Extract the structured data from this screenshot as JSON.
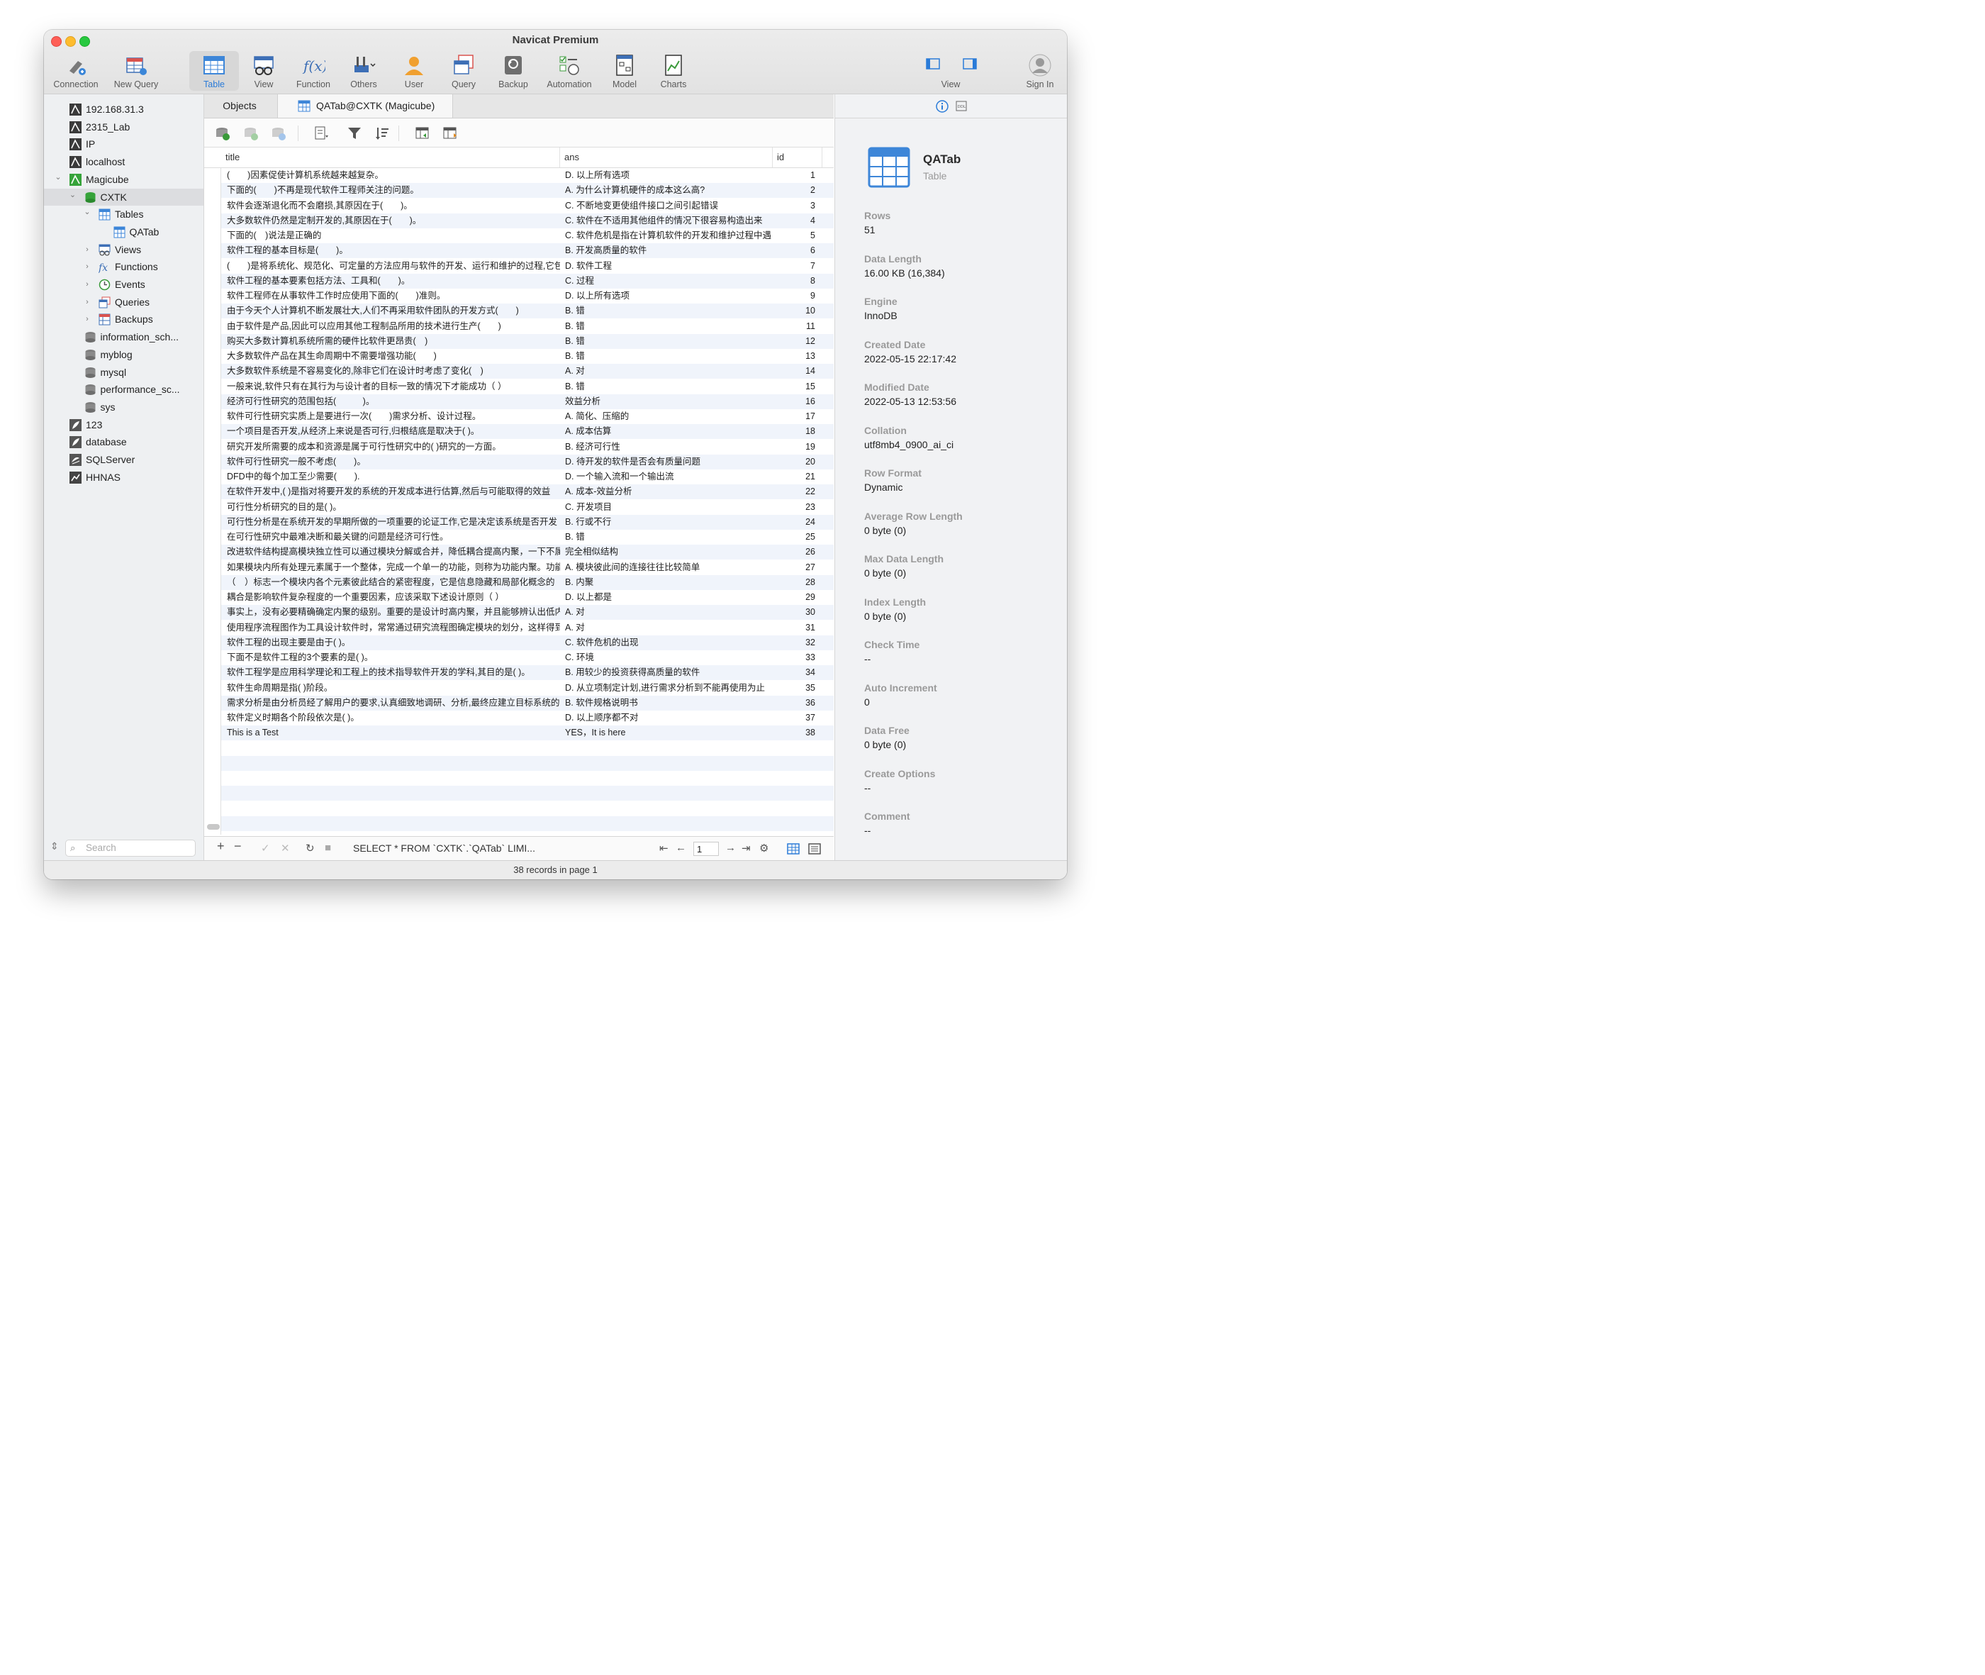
{
  "window": {
    "title": "Navicat Premium",
    "status": "38 records in page 1"
  },
  "toolbar": {
    "items": [
      {
        "label": "Connection",
        "icon": "connection-icon"
      },
      {
        "label": "New Query",
        "icon": "new-query-icon"
      },
      {
        "label": "Table",
        "icon": "table-icon",
        "active": true
      },
      {
        "label": "View",
        "icon": "view-icon"
      },
      {
        "label": "Function",
        "icon": "function-icon"
      },
      {
        "label": "Others",
        "icon": "others-icon"
      },
      {
        "label": "User",
        "icon": "user-icon"
      },
      {
        "label": "Query",
        "icon": "query-icon"
      },
      {
        "label": "Backup",
        "icon": "backup-icon"
      },
      {
        "label": "Automation",
        "icon": "automation-icon"
      },
      {
        "label": "Model",
        "icon": "model-icon"
      },
      {
        "label": "Charts",
        "icon": "charts-icon"
      }
    ],
    "view_label": "View",
    "signin_label": "Sign In"
  },
  "sidebar": {
    "items": [
      {
        "label": "192.168.31.3"
      },
      {
        "label": "2315_Lab"
      },
      {
        "label": "IP"
      },
      {
        "label": "localhost"
      },
      {
        "label": "Magicube"
      },
      {
        "label": "CXTK"
      },
      {
        "label": "Tables"
      },
      {
        "label": "QATab"
      },
      {
        "label": "Views"
      },
      {
        "label": "Functions"
      },
      {
        "label": "Events"
      },
      {
        "label": "Queries"
      },
      {
        "label": "Backups"
      },
      {
        "label": "information_sch..."
      },
      {
        "label": "myblog"
      },
      {
        "label": "mysql"
      },
      {
        "label": "performance_sc..."
      },
      {
        "label": "sys"
      },
      {
        "label": "123"
      },
      {
        "label": "database"
      },
      {
        "label": "SQLServer"
      },
      {
        "label": "HHNAS"
      }
    ],
    "search_placeholder": "Search"
  },
  "tabs": {
    "objects": "Objects",
    "active": "QATab@CXTK (Magicube)"
  },
  "grid": {
    "columns": [
      "title",
      "ans",
      "id"
    ],
    "rows": [
      [
        "(　　)因素促使计算机系统越来越复杂。",
        "D. 以上所有选项",
        "1"
      ],
      [
        "下面的(　　)不再是现代软件工程师关注的问题。",
        "A. 为什么计算机硬件的成本这么高?",
        "2"
      ],
      [
        "软件会逐渐退化而不会磨损,其原因在于(　　)。",
        "C. 不断地变更使组件接口之间引起错误",
        "3"
      ],
      [
        "大多数软件仍然是定制开发的,其原因在于(　　)。",
        "C. 软件在不适用其他组件的情况下很容易构造出来",
        "4"
      ],
      [
        "下面的(　)说法是正确的",
        "C. 软件危机是指在计算机软件的开发和维护过程中遇",
        "5"
      ],
      [
        "软件工程的基本目标是(　　)。",
        "B. 开发高质量的软件",
        "6"
      ],
      [
        "(　　)是将系统化、规范化、可定量的方法应用与软件的开发、运行和维护的过程,它包",
        "D. 软件工程",
        "7"
      ],
      [
        "软件工程的基本要素包括方法、工具和(　　)。",
        "C. 过程",
        "8"
      ],
      [
        "软件工程师在从事软件工作时应使用下面的(　　)准则。",
        "D. 以上所有选项",
        "9"
      ],
      [
        "由于今天个人计算机不断发展壮大,人们不再采用软件团队的开发方式(　　)",
        "B. 错",
        "10"
      ],
      [
        "由于软件是产品,因此可以应用其他工程制品所用的技术进行生产(　　)",
        "B. 错",
        "11"
      ],
      [
        "购买大多数计算机系统所需的硬件比软件更昂贵(　)",
        "B. 错",
        "12"
      ],
      [
        "大多数软件产品在其生命周期中不需要增强功能(　　)",
        "B. 错",
        "13"
      ],
      [
        "大多数软件系统是不容易变化的,除非它们在设计时考虑了变化(　)",
        "A. 对",
        "14"
      ],
      [
        "一般来说,软件只有在其行为与设计者的目标一致的情况下才能成功（ ）",
        "B. 错",
        "15"
      ],
      [
        "经济可行性研究的范围包括(　　　)。",
        "效益分析",
        "16"
      ],
      [
        "软件可行性研究实质上是要进行一次(　　)需求分析、设计过程。",
        "A. 简化、压缩的",
        "17"
      ],
      [
        "一个项目是否开发,从经济上来说是否可行,归根结底是取决于( )。",
        "A. 成本估算",
        "18"
      ],
      [
        "研究开发所需要的成本和资源是属于可行性研究中的( )研究的一方面。",
        "B. 经济可行性",
        "19"
      ],
      [
        "软件可行性研究一般不考虑(　　)。",
        "D. 待开发的软件是否会有质量问题",
        "20"
      ],
      [
        "DFD中的每个加工至少需要(　　).",
        "D. 一个输入流和一个输出流",
        "21"
      ],
      [
        "在软件开发中,( )是指对将要开发的系统的开发成本进行估算,然后与可能取得的效益",
        "A. 成本-效益分析",
        "22"
      ],
      [
        "可行性分析研究的目的是( )。",
        "C. 开发项目",
        "23"
      ],
      [
        "可行性分析是在系统开发的早期所做的一项重要的论证工作,它是决定该系统是否开发",
        "B. 行或不行",
        "24"
      ],
      [
        "在可行性研究中最难决断和最关键的问题是经济可行性。",
        "B. 错",
        "25"
      ],
      [
        "改进软件结构提高模块独立性可以通过模块分解或合并，降低耦合提高内聚，一下不属",
        "完全相似结构",
        "26"
      ],
      [
        "如果模块内所有处理元素属于一个整体，完成一个单一的功能，则称为功能内聚。功能",
        "A. 模块彼此间的连接往往比较简单",
        "27"
      ],
      [
        "（　）标志一个模块内各个元素彼此结合的紧密程度，它是信息隐藏和局部化概念的",
        "B. 内聚",
        "28"
      ],
      [
        "耦合是影响软件复杂程度的一个重要因素，应该采取下述设计原则（ ）",
        "D. 以上都是",
        "29"
      ],
      [
        "事实上，没有必要精确确定内聚的级别。重要的是设计时高内聚，并且能够辨认出低内",
        "A. 对",
        "30"
      ],
      [
        "使用程序流程图作为工具设计软件时，常常通过研究流程图确定模块的划分，这样得到",
        "A. 对",
        "31"
      ],
      [
        "软件工程的出现主要是由于( )。",
        "C. 软件危机的出现",
        "32"
      ],
      [
        "下面不是软件工程的3个要素的是( )。",
        "C. 环境",
        "33"
      ],
      [
        "软件工程学是应用科学理论和工程上的技术指导软件开发的学科,其目的是( )。",
        "B. 用较少的投资获得高质量的软件",
        "34"
      ],
      [
        "软件生命周期是指( )阶段。",
        "D. 从立项制定计划,进行需求分析到不能再使用为止",
        "35"
      ],
      [
        "需求分析是由分析员经了解用户的要求,认真细致地调研、分析,最终应建立目标系统的",
        "B. 软件规格说明书",
        "36"
      ],
      [
        "软件定义时期各个阶段依次是( )。",
        "D. 以上顺序都不对",
        "37"
      ],
      [
        "This is a Test",
        "YES，It is here",
        "38"
      ]
    ]
  },
  "bottombar": {
    "sql": "SELECT * FROM `CXTK`.`QATab` LIMI...",
    "page": "1"
  },
  "info": {
    "name": "QATab",
    "type": "Table",
    "props": [
      {
        "label": "Rows",
        "value": "51"
      },
      {
        "label": "Data Length",
        "value": "16.00 KB (16,384)"
      },
      {
        "label": "Engine",
        "value": "InnoDB"
      },
      {
        "label": "Created Date",
        "value": "2022-05-15 22:17:42"
      },
      {
        "label": "Modified Date",
        "value": "2022-05-13 12:53:56"
      },
      {
        "label": "Collation",
        "value": "utf8mb4_0900_ai_ci"
      },
      {
        "label": "Row Format",
        "value": "Dynamic"
      },
      {
        "label": "Average Row Length",
        "value": "0 byte (0)"
      },
      {
        "label": "Max Data Length",
        "value": "0 byte (0)"
      },
      {
        "label": "Index Length",
        "value": "0 byte (0)"
      },
      {
        "label": "Check Time",
        "value": "--"
      },
      {
        "label": "Auto Increment",
        "value": "0"
      },
      {
        "label": "Data Free",
        "value": "0 byte (0)"
      },
      {
        "label": "Create Options",
        "value": "--"
      },
      {
        "label": "Comment",
        "value": "--"
      }
    ]
  },
  "colors": {
    "accent": "#2a7bd8",
    "row_alt": "#f0f4fb",
    "sidebar_bg": "#eef0f2"
  }
}
